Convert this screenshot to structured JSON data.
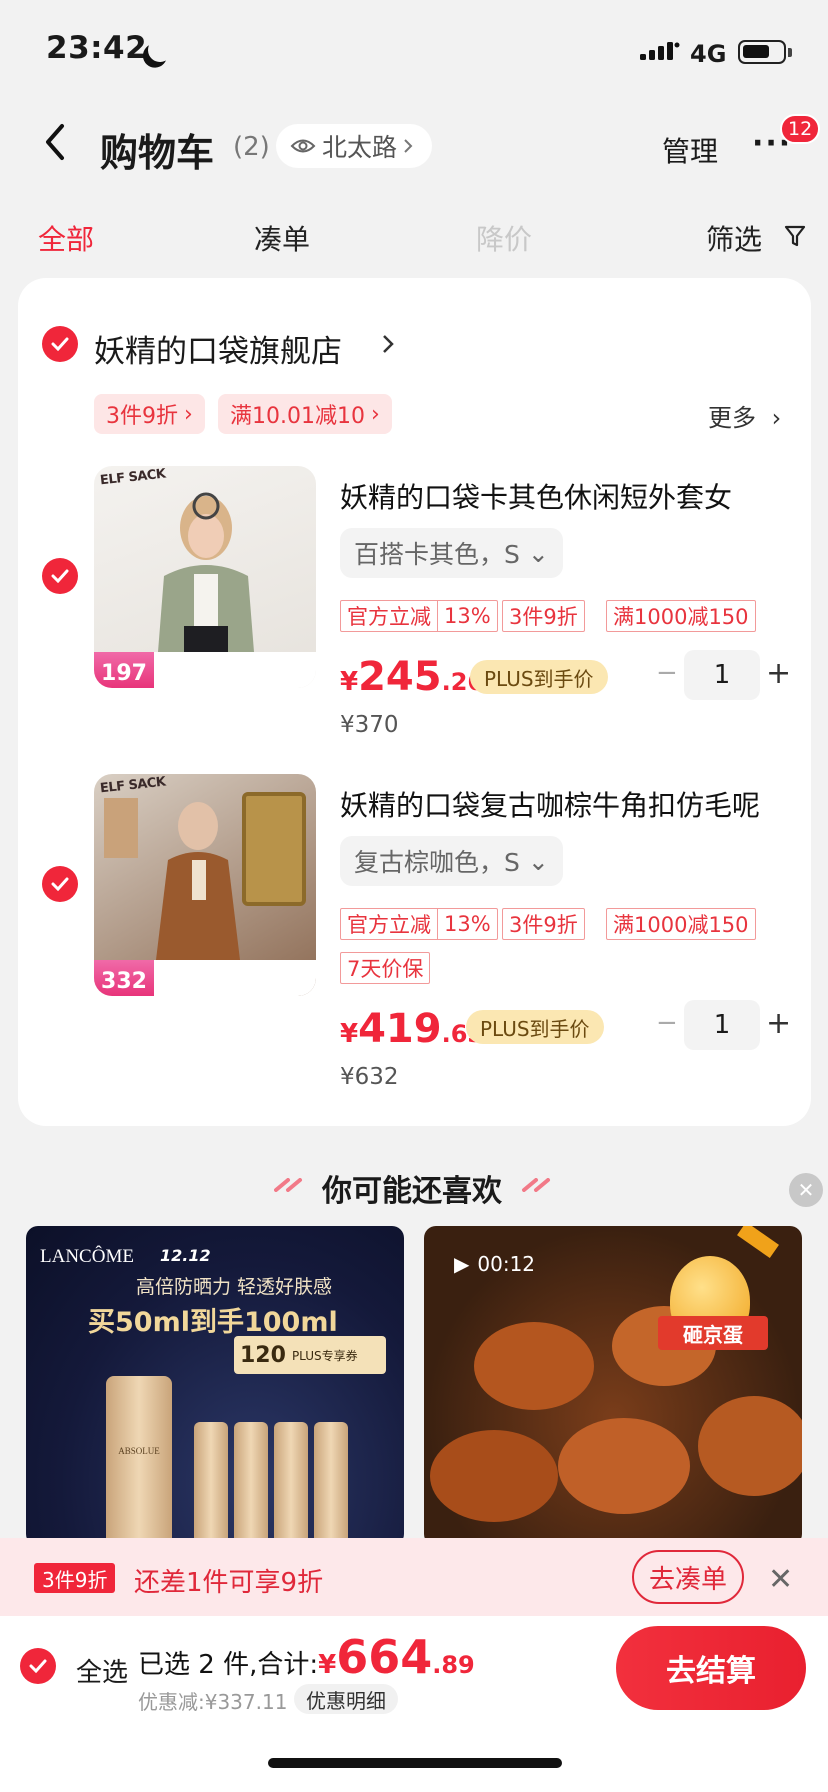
{
  "status": {
    "time": "23:42",
    "network": "4G"
  },
  "header": {
    "title": "购物车",
    "count": "(2)",
    "location": "北太路",
    "manage": "管理",
    "more": "···",
    "badge": "12"
  },
  "tabs": {
    "all": "全部",
    "bundle": "凑单",
    "price_drop": "降价",
    "filter": "筛选"
  },
  "store": {
    "name": "妖精的口袋旗舰店",
    "promos": [
      "3件9折",
      "满10.01减10"
    ],
    "more": "更多"
  },
  "products": [
    {
      "brand": "ELF SACK",
      "thumb_number": "197",
      "title": "妖精的口袋卡其色休闲短外套女",
      "spec": "百搭卡其色，S",
      "offer_tags": [
        {
          "head": "官方立减",
          "tail": "13%"
        },
        {
          "head": "3件9折",
          "tail": ""
        },
        {
          "head": "满1000减150",
          "tail": ""
        }
      ],
      "extra_tag": "",
      "price_currency": "¥",
      "price_int": "245",
      "price_dec": ".26",
      "plus_label": "PLUS到手价",
      "quantity": "1",
      "original_price": "¥370"
    },
    {
      "brand": "ELF SACK",
      "thumb_number": "332",
      "title": "妖精的口袋复古咖棕牛角扣仿毛呢",
      "spec": "复古棕咖色，S",
      "offer_tags": [
        {
          "head": "官方立减",
          "tail": "13%"
        },
        {
          "head": "3件9折",
          "tail": ""
        },
        {
          "head": "满1000减150",
          "tail": ""
        }
      ],
      "extra_tag": "7天价保",
      "price_currency": "¥",
      "price_int": "419",
      "price_dec": ".63",
      "plus_label": "PLUS到手价",
      "quantity": "1",
      "original_price": "¥632"
    }
  ],
  "recommend": {
    "title": "你可能还喜欢",
    "left": {
      "brand": "LANCÔME",
      "event": "12.12",
      "headline": "高倍防晒力 轻透好肤感",
      "offer": "买50ml到手100ml",
      "coupon_value": "120",
      "coupon_label": "PLUS专享券",
      "bottle_label": "ABSOLUE"
    },
    "right": {
      "duration": "00:12",
      "egg_label": "砸京蛋"
    }
  },
  "bundle_bar": {
    "tag": "3件9折",
    "text": "还差1件可享9折",
    "button": "去凑单"
  },
  "footer": {
    "select_all": "全选",
    "selected_text": "已选 2 件,合计:",
    "total_currency": "¥",
    "total_int": "664",
    "total_dec": ".89",
    "discount": "优惠减:¥337.11",
    "detail": "优惠明细",
    "checkout": "去结算"
  },
  "colors": {
    "accent": "#f0263a",
    "plus_gold": "#fbe7b2",
    "promo_bg": "#fde6e6"
  }
}
